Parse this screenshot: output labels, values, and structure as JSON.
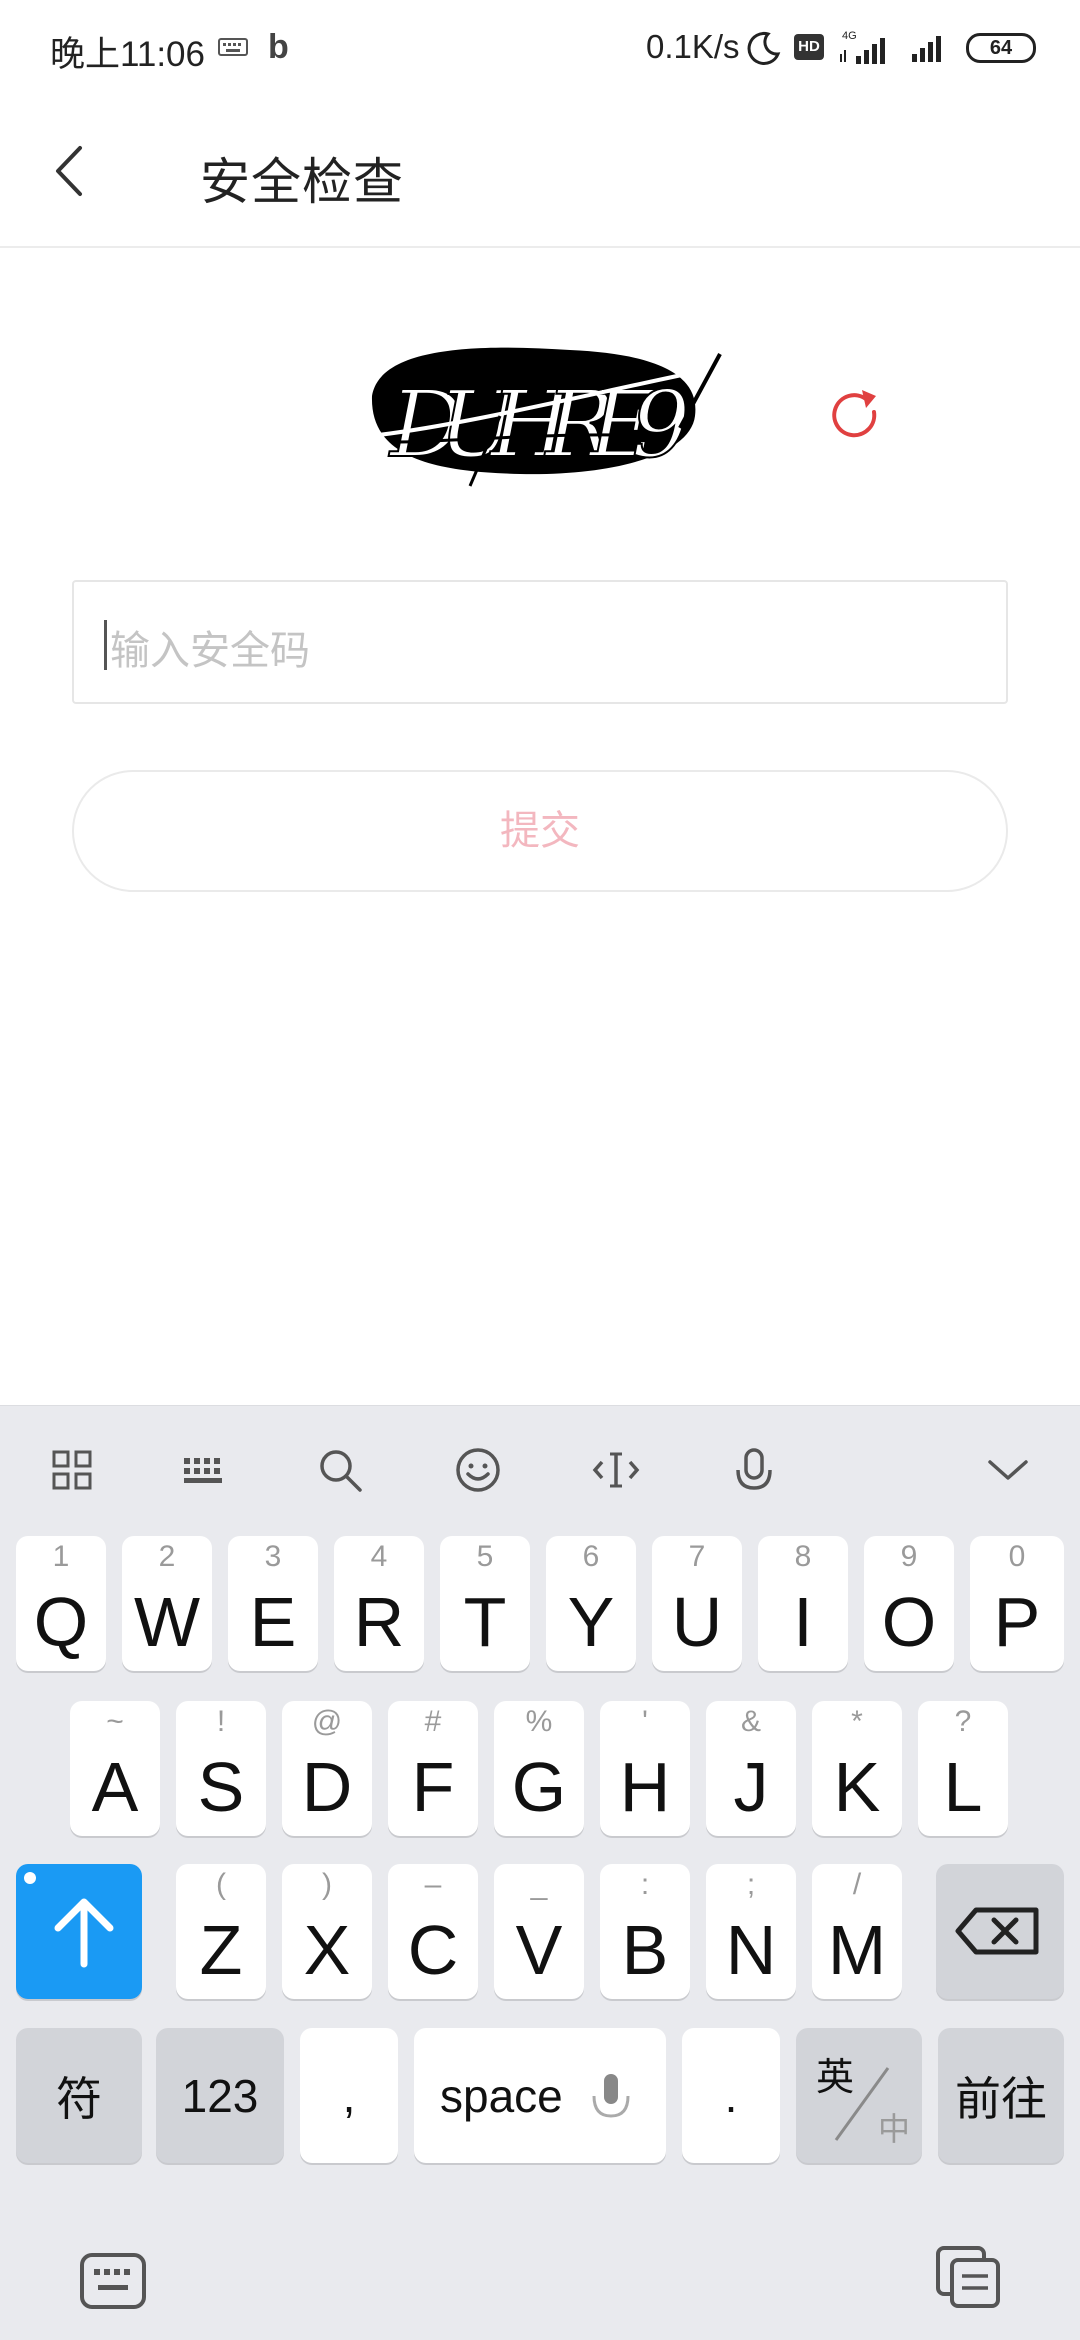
{
  "status_bar": {
    "time": "晚上11:06",
    "net_speed": "0.1K/s",
    "hd_label": "HD",
    "network_type": "4G",
    "battery": "64"
  },
  "header": {
    "title": "安全检查"
  },
  "captcha": {
    "text": "DUHRE9"
  },
  "form": {
    "input_placeholder": "输入安全码",
    "submit_label": "提交"
  },
  "keyboard": {
    "row1": [
      {
        "key": "Q",
        "hint": "1"
      },
      {
        "key": "W",
        "hint": "2"
      },
      {
        "key": "E",
        "hint": "3"
      },
      {
        "key": "R",
        "hint": "4"
      },
      {
        "key": "T",
        "hint": "5"
      },
      {
        "key": "Y",
        "hint": "6"
      },
      {
        "key": "U",
        "hint": "7"
      },
      {
        "key": "I",
        "hint": "8"
      },
      {
        "key": "O",
        "hint": "9"
      },
      {
        "key": "P",
        "hint": "0"
      }
    ],
    "row2": [
      {
        "key": "A",
        "hint": "~"
      },
      {
        "key": "S",
        "hint": "!"
      },
      {
        "key": "D",
        "hint": "@"
      },
      {
        "key": "F",
        "hint": "#"
      },
      {
        "key": "G",
        "hint": "%"
      },
      {
        "key": "H",
        "hint": "'"
      },
      {
        "key": "J",
        "hint": "&"
      },
      {
        "key": "K",
        "hint": "*"
      },
      {
        "key": "L",
        "hint": "?"
      }
    ],
    "row3": [
      {
        "key": "Z",
        "hint": "("
      },
      {
        "key": "X",
        "hint": ")"
      },
      {
        "key": "C",
        "hint": "–"
      },
      {
        "key": "V",
        "hint": "_"
      },
      {
        "key": "B",
        "hint": ":"
      },
      {
        "key": "N",
        "hint": ";"
      },
      {
        "key": "M",
        "hint": "/"
      }
    ],
    "symbols_label": "符",
    "numbers_label": "123",
    "comma_label": ",",
    "space_label": "space",
    "period_label": ".",
    "lang_en": "英",
    "lang_zh": "中",
    "go_label": "前往",
    "accent_color": "#1a9af4"
  }
}
